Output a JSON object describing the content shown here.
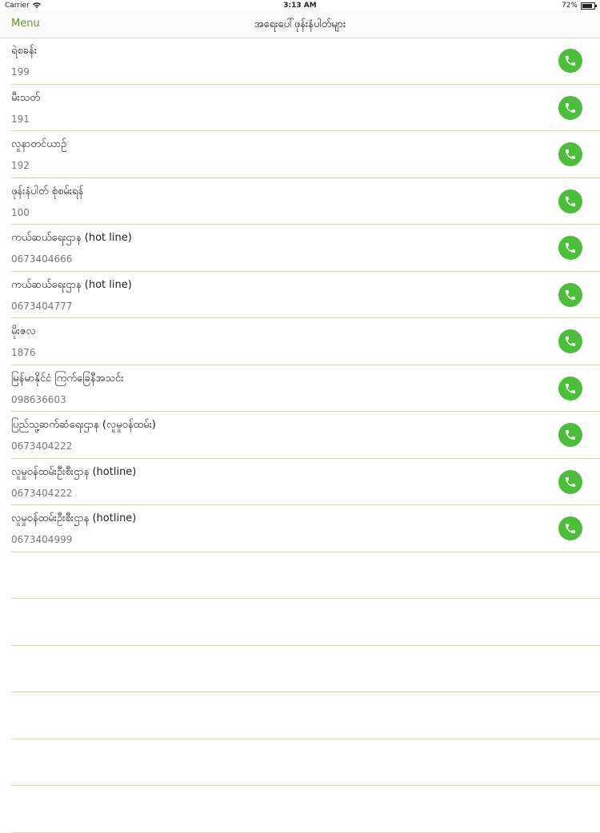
{
  "status_bar": {
    "carrier": "Carrier",
    "time": "3:13 AM",
    "battery": "72%",
    "wifi_icon": "wifi-icon",
    "battery_icon": "battery-icon"
  },
  "nav": {
    "menu_label": "Menu",
    "title": "အရေးပေါ်ဖုန်းနံပါတ်များ"
  },
  "colors": {
    "accent": "#5aa02c",
    "call_button": "#4cbf3a",
    "separator": "#cfe0b8"
  },
  "contacts": [
    {
      "name": "ရဲစခန်း",
      "number": "199"
    },
    {
      "name": "မီးသတ်",
      "number": "191"
    },
    {
      "name": "လူနာတင်ယာဉ်",
      "number": "192"
    },
    {
      "name": "ဖုန်းနံပါတ် စုံစမ်းရန်",
      "number": "100"
    },
    {
      "name": "ကယ်ဆယ်ရေးဌာန (hot line)",
      "number": "0673404666"
    },
    {
      "name": "ကယ်ဆယ်ရေးဌာန (hot line)",
      "number": "0673404777"
    },
    {
      "name": "မိုးဇလ",
      "number": "1876"
    },
    {
      "name": "မြန်မာနိုင်ငံ ကြက်ခြေနီအသင်း",
      "number": "098636603"
    },
    {
      "name": "ပြည်သူ့ဆက်ဆံရေးဌာန (လူမှုဝန်ထမ်း)",
      "number": "0673404222"
    },
    {
      "name": "လူမှုဝန်ထမ်းဦးစီးဌာန (hotline)",
      "number": "0673404222"
    },
    {
      "name": "လူမှုဝန်ထမ်းဦးစီးဌာန (hotline)",
      "number": "0673404999"
    }
  ],
  "call_icon": "phone-icon"
}
